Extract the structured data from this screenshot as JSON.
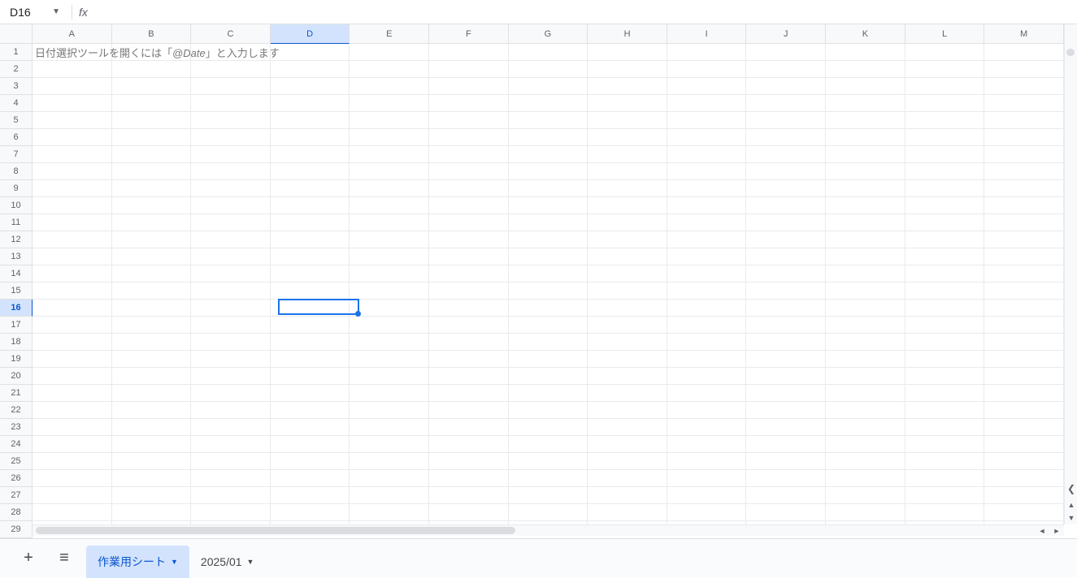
{
  "name_box": "D16",
  "formula_value": "",
  "columns": [
    "A",
    "B",
    "C",
    "D",
    "E",
    "F",
    "G",
    "H",
    "I",
    "J",
    "K",
    "L",
    "M"
  ],
  "rows": [
    "1",
    "2",
    "3",
    "4",
    "5",
    "6",
    "7",
    "8",
    "9",
    "10",
    "11",
    "12",
    "13",
    "14",
    "15",
    "16",
    "17",
    "18",
    "19",
    "20",
    "21",
    "22",
    "23",
    "24",
    "25",
    "26",
    "27",
    "28",
    "29"
  ],
  "selected_col_index": 3,
  "selected_row_index": 15,
  "cells": {
    "A1_prefix": "日付選択ツールを開くには「",
    "A1_italic": "@Date",
    "A1_suffix": "」と入力します"
  },
  "tabs": {
    "active": "作業用シート",
    "other": "2025/01"
  },
  "icons": {
    "plus": "+",
    "menu": "≡",
    "dropdown": "▼",
    "fx": "fx",
    "left": "◄",
    "right": "►",
    "up": "▲",
    "down": "▼",
    "explore": "❮"
  }
}
